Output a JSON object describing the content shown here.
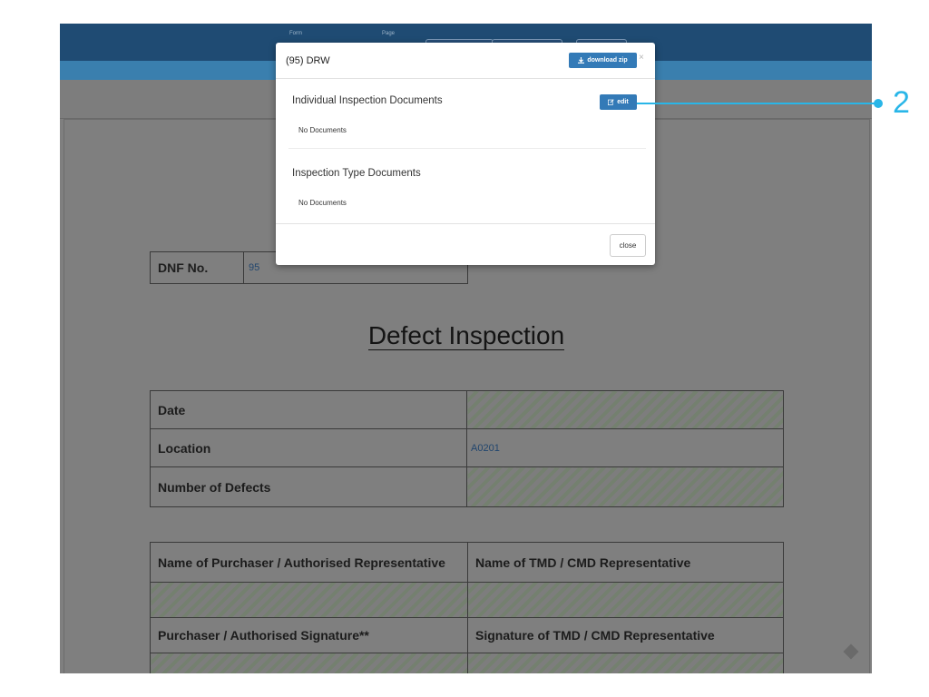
{
  "topbar": {
    "form_label": "Form",
    "page_label": "Page"
  },
  "document": {
    "dnf_label": "DNF No.",
    "dnf_value": "95",
    "title": "Defect Inspection",
    "info_rows": [
      {
        "label": "Date",
        "value": ""
      },
      {
        "label": "Location",
        "value": "A0201"
      },
      {
        "label": "Number of Defects",
        "value": ""
      }
    ],
    "rep_headers": [
      "Name of Purchaser / Authorised Representative",
      "Name of TMD / CMD Representative"
    ],
    "sig_headers": [
      "Purchaser / Authorised Signature**",
      "Signature of TMD / CMD Representative"
    ]
  },
  "modal": {
    "title": "(95) DRW",
    "download_label": "download zip",
    "close_x": "×",
    "sections": [
      {
        "title": "Individual Inspection Documents",
        "empty_text": "No Documents",
        "edit_label": "edit"
      },
      {
        "title": "Inspection Type Documents",
        "empty_text": "No Documents"
      }
    ],
    "close_label": "close"
  },
  "callout": {
    "number": "2"
  },
  "colors": {
    "accent": "#337ab7",
    "callout": "#29b6e8",
    "topbar": "#1f4b73"
  }
}
